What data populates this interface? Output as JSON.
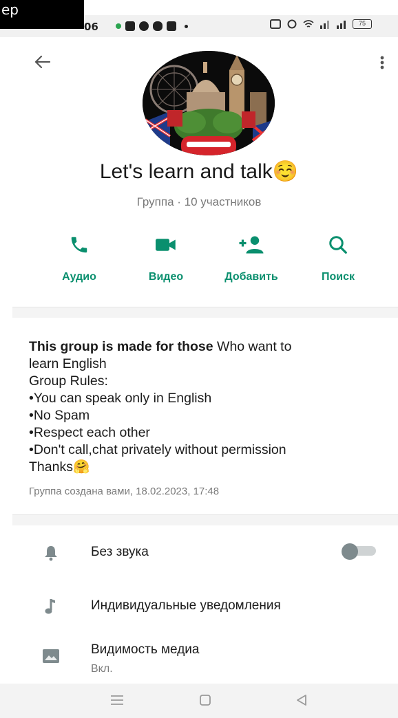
{
  "overlay": {
    "text": "ep"
  },
  "status_bar": {
    "time": "06",
    "battery": "75"
  },
  "group": {
    "name": "Let's learn and talk☺️",
    "subtitle": "Группа · 10 участников"
  },
  "actions": [
    {
      "label": "Аудио",
      "icon": "phone-icon"
    },
    {
      "label": "Видео",
      "icon": "video-icon"
    },
    {
      "label": "Добавить",
      "icon": "add-person-icon"
    },
    {
      "label": "Поиск",
      "icon": "search-icon"
    }
  ],
  "description": {
    "bold": "This group is made for those",
    "lines": [
      " Who want to",
      "learn English",
      "Group Rules:",
      "•You can speak only in English",
      "•No Spam",
      "•Respect  each other",
      "•Don't call,chat privately without permission",
      "Thanks🤗"
    ],
    "created": "Группа создана вами, 18.02.2023, 17:48"
  },
  "settings": [
    {
      "label": "Без звука",
      "icon": "bell-icon",
      "toggle": false
    },
    {
      "label": "Индивидуальные уведомления",
      "icon": "music-note-icon"
    },
    {
      "label": "Видимость медиа",
      "sub": "Вкл.",
      "icon": "image-icon"
    }
  ],
  "colors": {
    "accent": "#0a8f6e",
    "muted": "#7a7a7a"
  }
}
